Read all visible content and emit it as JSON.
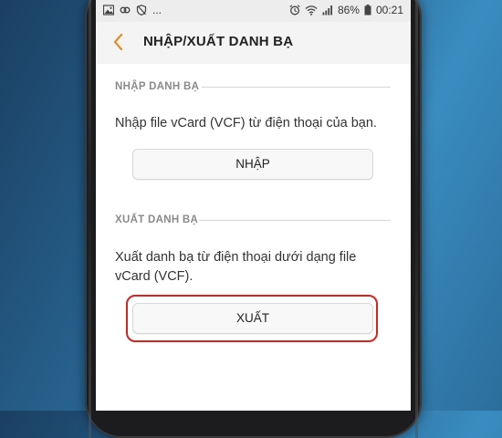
{
  "status_bar": {
    "overflow": "...",
    "battery_percent": "86%",
    "time": "00:21"
  },
  "app_bar": {
    "title": "NHẬP/XUẤT DANH BẠ"
  },
  "import_section": {
    "header": "NHẬP DANH BẠ",
    "description": "Nhập file vCard (VCF) từ điện thoại của bạn.",
    "button_label": "NHẬP"
  },
  "export_section": {
    "header": "XUẤT DANH BẠ",
    "description": "Xuất danh bạ từ điện thoại dưới dạng file vCard (VCF).",
    "button_label": "XUẤT"
  },
  "colors": {
    "accent": "#e58e26",
    "highlight": "#d9231c"
  },
  "icons": {
    "back": "chevron-left-icon",
    "status_left": [
      "image-icon",
      "link-icon",
      "shield-off-icon"
    ],
    "status_right": [
      "alarm-icon",
      "wifi-icon",
      "signal-icon",
      "battery-icon"
    ]
  }
}
